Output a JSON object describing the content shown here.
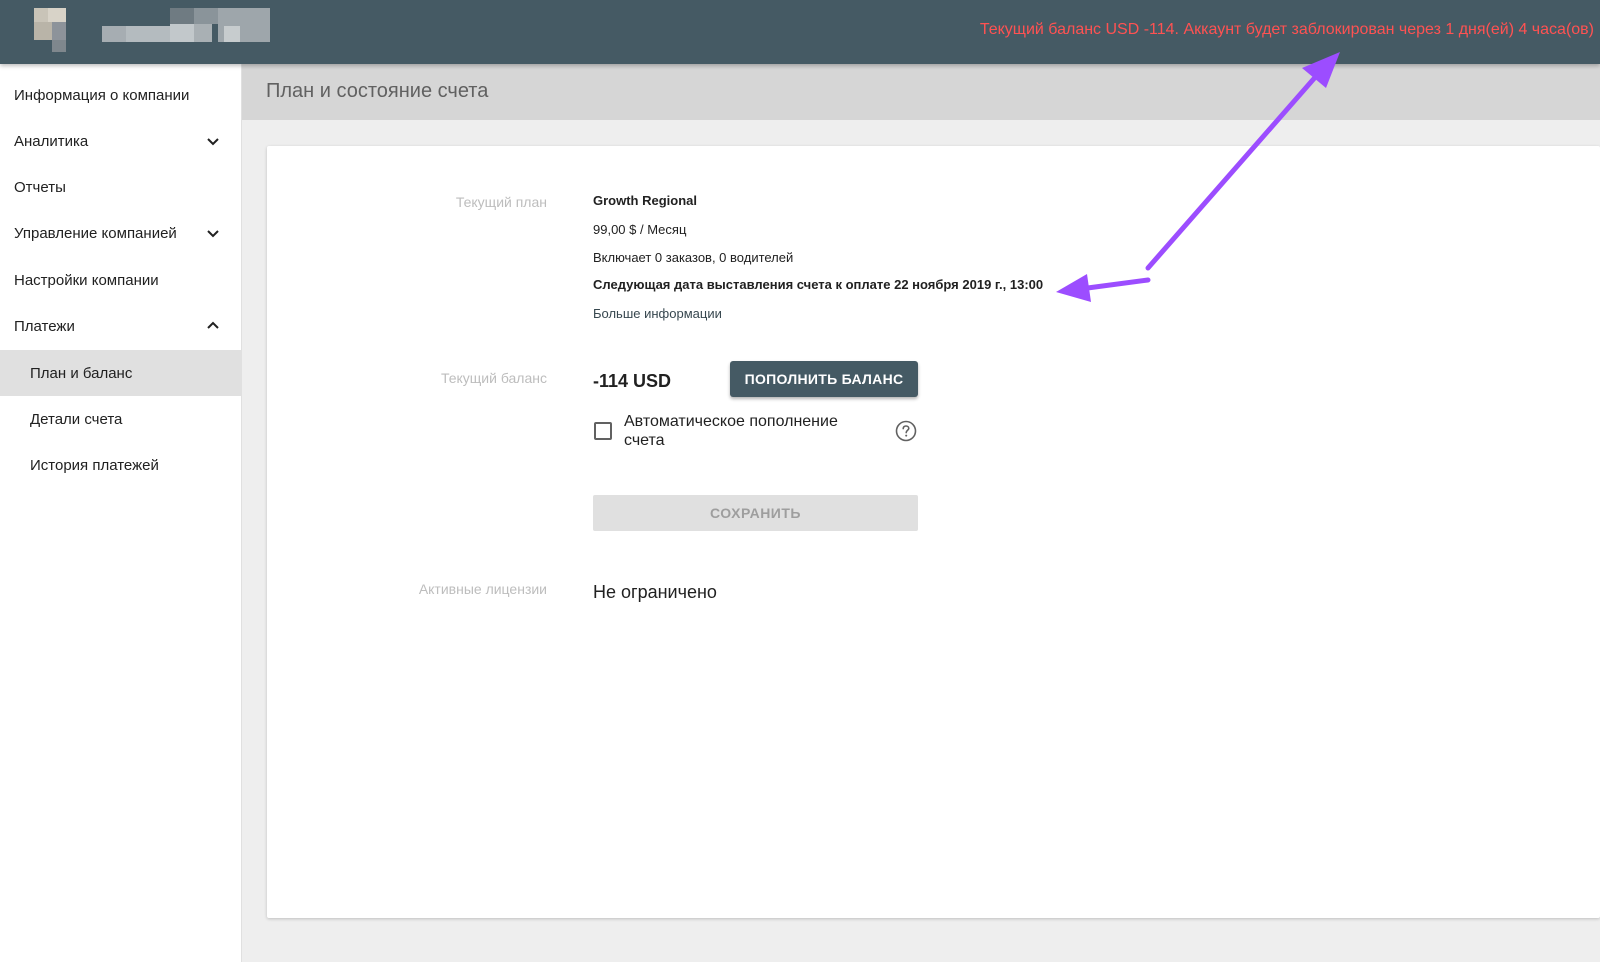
{
  "header": {
    "warning_text": "Текущий баланс USD -114. Аккаунт будет заблокирован через 1 дня(ей) 4 часа(ов)"
  },
  "sidebar": {
    "items": [
      {
        "label": "Информация о компании"
      },
      {
        "label": "Аналитика"
      },
      {
        "label": "Отчеты"
      },
      {
        "label": "Управление компанией"
      },
      {
        "label": "Настройки компании"
      },
      {
        "label": "Платежи"
      },
      {
        "label": "План и баланс"
      },
      {
        "label": "Детали счета"
      },
      {
        "label": "История платежей"
      }
    ]
  },
  "page": {
    "title": "План и состояние счета"
  },
  "plan": {
    "label": "Текущий план",
    "name": "Growth Regional",
    "price": "99,00 $ / Месяц",
    "includes": "Включает 0 заказов, 0 водителей",
    "next_billing": "Следующая дата выставления счета к оплате 22 ноября 2019 г., 13:00",
    "more_info": "Больше информации"
  },
  "balance": {
    "label": "Текущий баланс",
    "value": "-114 USD",
    "topup_button": "ПОПОЛНИТЬ БАЛАНС",
    "auto_topup_label": "Автоматическое пополнение счета",
    "auto_topup_checked": false,
    "save_button": "СОХРАНИТЬ"
  },
  "licenses": {
    "label": "Активные лицензии",
    "value": "Не ограничено"
  },
  "colors": {
    "topbar": "#455a64",
    "warning": "#ff5252",
    "arrow": "#9c4dff"
  },
  "icons": {
    "expand": "chevron-down-icon",
    "collapse": "chevron-up-icon",
    "help": "help-circle-icon"
  }
}
